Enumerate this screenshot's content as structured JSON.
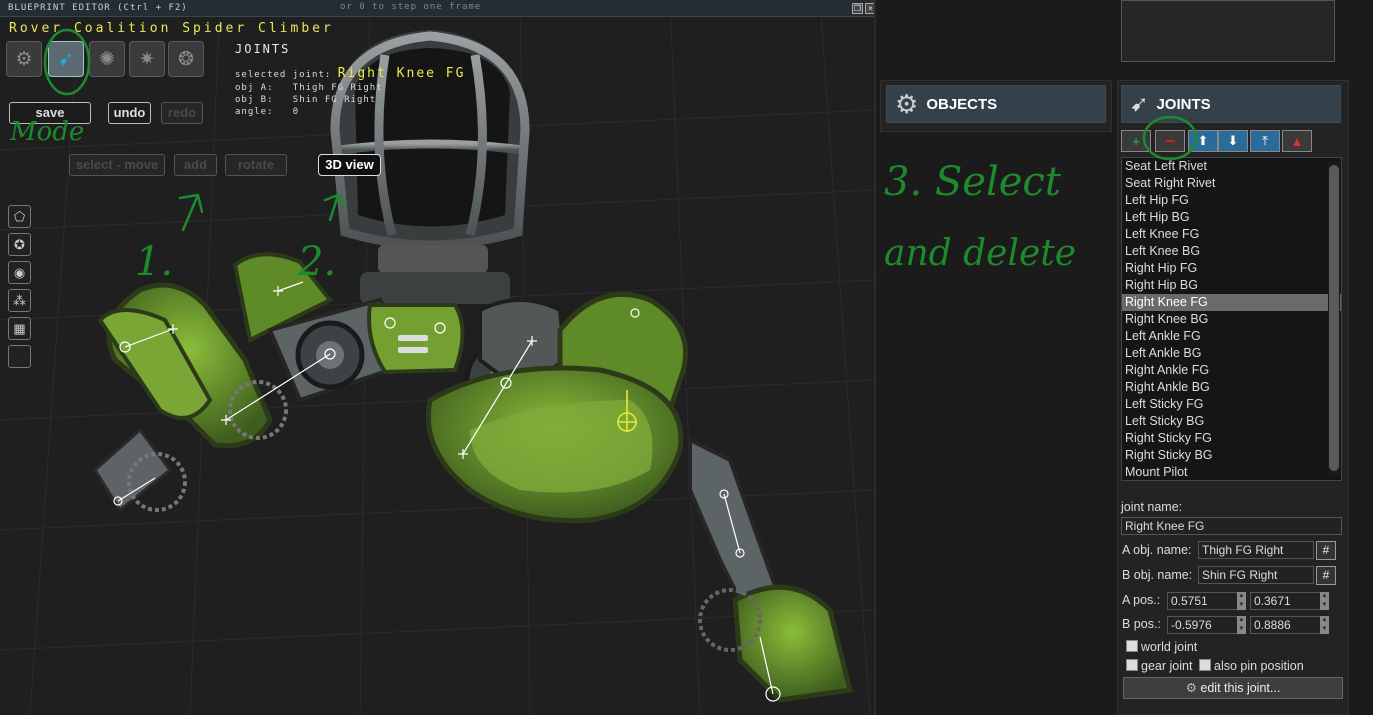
{
  "editor": {
    "window_title": "BLUEPRINT EDITOR (Ctrl + F2)",
    "hint": "or 0 to step one frame",
    "blueprint_name": "Rover Coalition Spider Climber",
    "mode_icons": [
      "object-mode-icon",
      "joint-mode-icon",
      "shape-mode-icon",
      "particle-mode-icon",
      "texture-mode-icon"
    ],
    "joint_panel": {
      "title": "JOINTS",
      "selected_label": "selected joint:",
      "selected_value": "Right Knee FG",
      "obj_a_label": "obj A:",
      "obj_a_value": "Thigh FG Right",
      "obj_b_label": "obj B:",
      "obj_b_value": "Shin FG Right",
      "angle_label": "angle:",
      "angle_value": "0"
    },
    "toolbar": {
      "save": "save",
      "undo": "undo",
      "redo": "redo",
      "select_move": "select - move",
      "add": "add",
      "rotate": "rotate",
      "view3d": "3D view"
    }
  },
  "annotations": {
    "mode": "Mode",
    "step1": "1.",
    "step2": "2.",
    "step3_line1": "3. Select",
    "step3_line2": "and delete"
  },
  "sidebar": {
    "objects_header": "OBJECTS",
    "joints_header": "JOINTS",
    "joint_list": [
      "Seat Left Rivet",
      "Seat Right Rivet",
      "Left Hip FG",
      "Left Hip BG",
      "Left Knee FG",
      "Left Knee BG",
      "Right Hip FG",
      "Right Hip BG",
      "Right Knee FG",
      "Right Knee BG",
      "Left Ankle FG",
      "Left Ankle BG",
      "Right Ankle FG",
      "Right Ankle BG",
      "Left Sticky FG",
      "Left Sticky BG",
      "Right Sticky FG",
      "Right Sticky BG",
      "Mount Pilot"
    ],
    "selected_index": 8,
    "props": {
      "joint_name_label": "joint name:",
      "joint_name": "Right Knee FG",
      "a_obj_label": "A obj. name:",
      "a_obj": "Thigh FG Right",
      "b_obj_label": "B obj. name:",
      "b_obj": "Shin FG Right",
      "hash": "#",
      "a_pos_label": "A pos.:",
      "a_pos_x": "0.5751",
      "a_pos_y": "0.3671",
      "b_pos_label": "B pos.:",
      "b_pos_x": "-0.5976",
      "b_pos_y": "0.8886",
      "world_joint": "world joint",
      "gear_joint": "gear joint",
      "also_pin": "also pin position",
      "edit_button": "edit this joint..."
    }
  },
  "colors": {
    "accent_yellow": "#ecec4a",
    "annotation_green": "#1d8a2e",
    "header_blue": "#34414a",
    "robot_green": "#6e9a2c"
  }
}
